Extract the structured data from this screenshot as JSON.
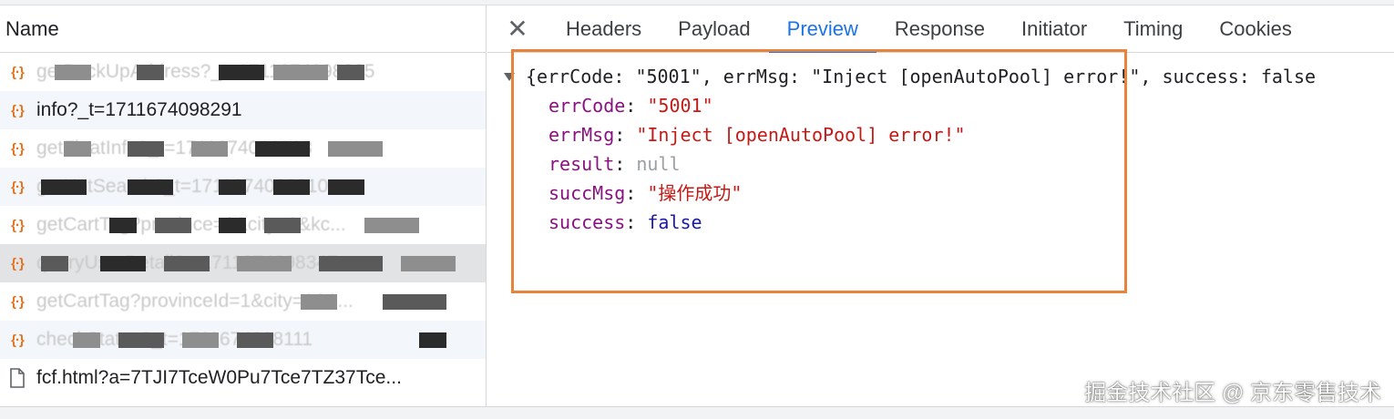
{
  "left_panel": {
    "column_header": "Name",
    "requests": [
      {
        "icon": "xhr-icon",
        "name": "getBackUpAddress?_t=1711674098295",
        "blurred": true
      },
      {
        "icon": "xhr-icon",
        "name": "info?_t=1711674098291",
        "blurred": false
      },
      {
        "icon": "xhr-icon",
        "name": "getFloatInfo?_t=1711674098263",
        "blurred": true
      },
      {
        "icon": "xhr-icon",
        "name": "getHotSearch?_t=1711674098310",
        "blurred": true
      },
      {
        "icon": "xhr-icon",
        "name": "getCartTag?province=1&city=1&kc...",
        "blurred": true
      },
      {
        "icon": "xhr-icon",
        "name": "queryUserDetail?t=1711674098347...",
        "blurred": true,
        "selected": true
      },
      {
        "icon": "xhr-icon",
        "name": "getCartTag?provinceId=1&city=1&1...",
        "blurred": true
      },
      {
        "icon": "xhr-icon",
        "name": "checkStatus?_t=1711674098111",
        "blurred": true
      },
      {
        "icon": "document-icon",
        "name": "fcf.html?a=7TJI7TceW0Pu7Tce7TZ37Tce...",
        "blurred": false
      }
    ]
  },
  "tabs": {
    "close_label": "✕",
    "items": [
      "Headers",
      "Payload",
      "Preview",
      "Response",
      "Initiator",
      "Timing",
      "Cookies"
    ],
    "active": "Preview"
  },
  "preview": {
    "summary": {
      "open": "{",
      "k1": "errCode",
      "v1": "\"5001\"",
      "k2": "errMsg",
      "v2": "\"Inject [openAutoPool] error!\"",
      "k3": "success",
      "v3": "false"
    },
    "props": [
      {
        "key": "errCode",
        "value": "\"5001\"",
        "type": "string"
      },
      {
        "key": "errMsg",
        "value": "\"Inject [openAutoPool] error!\"",
        "type": "string"
      },
      {
        "key": "result",
        "value": "null",
        "type": "null"
      },
      {
        "key": "succMsg",
        "value": "\"操作成功\"",
        "type": "string"
      },
      {
        "key": "success",
        "value": "false",
        "type": "boolean"
      }
    ]
  },
  "watermark": "掘金技术社区 @ 京东零售技术",
  "colors": {
    "accent": "#1a73e8",
    "highlight_box": "#e8833a",
    "xhr_icon": "#e8711a",
    "json_key": "#881280",
    "json_string": "#c41a16",
    "json_boolean": "#1a1aa6"
  }
}
